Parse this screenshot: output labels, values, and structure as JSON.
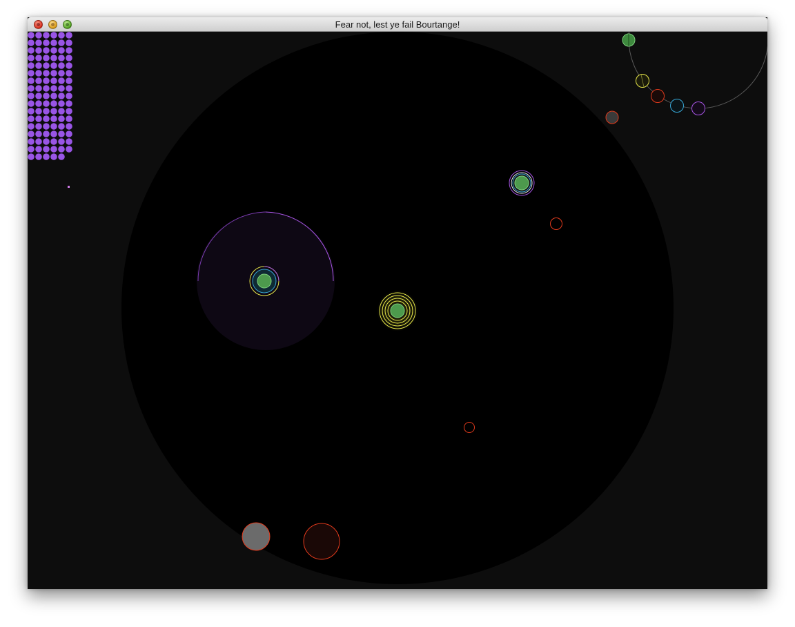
{
  "window": {
    "title": "Fear not, lest ye fail Bourtange!"
  },
  "colors": {
    "background": "#0d0d0d",
    "arena": "#000000",
    "ammo": "#9955e6",
    "player_green": "#4d9a4d",
    "enemy_red": "#e23a1c",
    "yellow": "#e8e84a",
    "cyan": "#38a8d8",
    "purple": "#a855e6"
  },
  "ammo": {
    "remaining_dots": 101
  },
  "icons": {
    "close": "close-icon",
    "minimize": "minimize-icon",
    "zoom": "zoom-icon"
  }
}
